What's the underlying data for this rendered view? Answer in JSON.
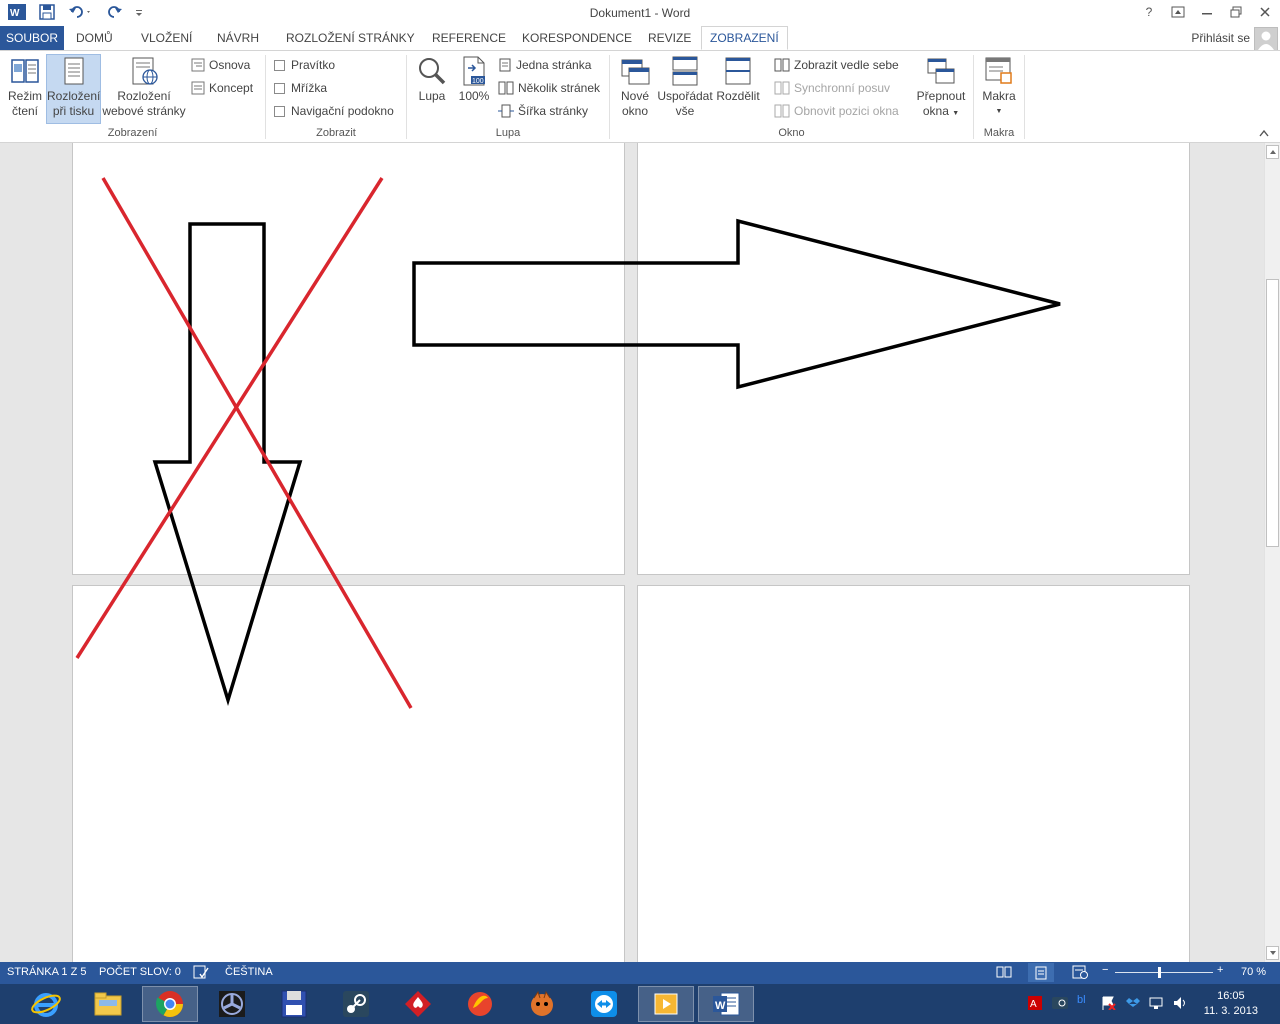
{
  "window": {
    "title": "Dokument1 - Word",
    "help": "?",
    "signin": "Přihlásit se"
  },
  "tabs": [
    {
      "label": "SOUBOR"
    },
    {
      "label": "DOMŮ"
    },
    {
      "label": "VLOŽENÍ"
    },
    {
      "label": "NÁVRH"
    },
    {
      "label": "ROZLOŽENÍ STRÁNKY"
    },
    {
      "label": "REFERENCE"
    },
    {
      "label": "KORESPONDENCE"
    },
    {
      "label": "REVIZE"
    },
    {
      "label": "ZOBRAZENÍ"
    }
  ],
  "ribbon": {
    "zobrazeni": {
      "group_label": "Zobrazení",
      "rezim_cteni": [
        "Režim",
        "čtení"
      ],
      "rozlozeni_tisk": [
        "Rozložení",
        "při tisku"
      ],
      "rozlozeni_web": [
        "Rozložení",
        "webové stránky"
      ],
      "osnova": "Osnova",
      "koncept": "Koncept"
    },
    "zobrazit": {
      "group_label": "Zobrazit",
      "pravitko": "Pravítko",
      "mrizka": "Mřížka",
      "navigacni": "Navigační podokno"
    },
    "lupa": {
      "group_label": "Lupa",
      "lupa": "Lupa",
      "sto": "100%",
      "jedna": "Jedna stránka",
      "nekolik": "Několik stránek",
      "sirka": "Šířka stránky"
    },
    "okno": {
      "group_label": "Okno",
      "nove": [
        "Nové",
        "okno"
      ],
      "usporadat": [
        "Uspořádat",
        "vše"
      ],
      "rozdelit": "Rozdělit",
      "vedle": "Zobrazit vedle sebe",
      "synchronni": "Synchronní posuv",
      "obnovit": "Obnovit pozici okna",
      "prepnout": [
        "Přepnout",
        "okna"
      ]
    },
    "makra": {
      "group_label": "Makra",
      "makra": "Makra"
    }
  },
  "status": {
    "page": "STRÁNKA 1 Z 5",
    "words": "POČET SLOV: 0",
    "language": "ČEŠTINA",
    "zoom": "70 %",
    "zoom_fraction": 0.45
  },
  "taskbar": {
    "time": "16:05",
    "date": "11. 3. 2013",
    "apps": [
      "internet-explorer",
      "file-explorer",
      "chrome",
      "fan-app",
      "save-app",
      "steam",
      "poker",
      "flash-app",
      "game-app",
      "teamviewer",
      "media-player",
      "word"
    ]
  },
  "colors": {
    "accent": "#2b579a",
    "cross": "#d9262e",
    "taskbar": "#1e3f6e"
  }
}
